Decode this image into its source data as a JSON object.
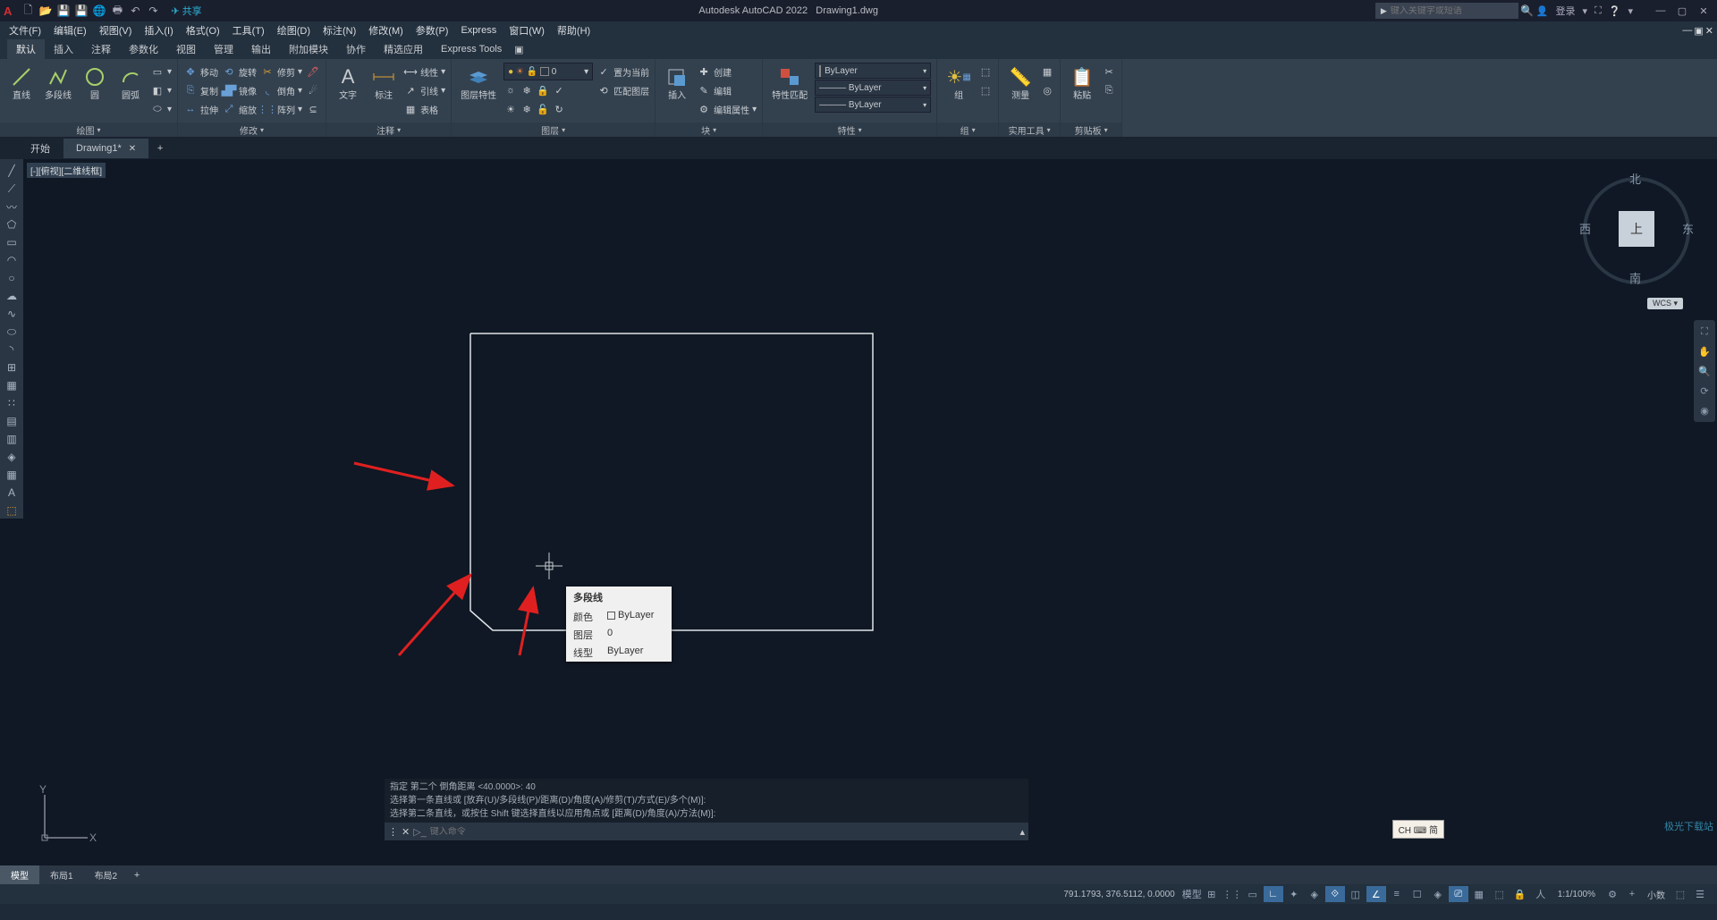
{
  "titlebar": {
    "app_name": "Autodesk AutoCAD 2022",
    "doc_name": "Drawing1.dwg",
    "share": "共享",
    "search_placeholder": "键入关键字或短语",
    "login": "登录"
  },
  "menu": {
    "items": [
      "文件(F)",
      "编辑(E)",
      "视图(V)",
      "插入(I)",
      "格式(O)",
      "工具(T)",
      "绘图(D)",
      "标注(N)",
      "修改(M)",
      "参数(P)",
      "Express",
      "窗口(W)",
      "帮助(H)"
    ]
  },
  "ribbon_tabs": [
    "默认",
    "插入",
    "注释",
    "参数化",
    "视图",
    "管理",
    "输出",
    "附加模块",
    "协作",
    "精选应用",
    "Express Tools"
  ],
  "ribbon": {
    "draw": {
      "title": "绘图",
      "line": "直线",
      "polyline": "多段线",
      "circle": "圆",
      "arc": "圆弧"
    },
    "modify": {
      "title": "修改",
      "move": "移动",
      "rotate": "旋转",
      "trim": "修剪",
      "copy": "复制",
      "mirror": "镜像",
      "fillet": "倒角",
      "stretch": "拉伸",
      "scale": "缩放",
      "array": "阵列"
    },
    "annot": {
      "title": "注释",
      "text": "文字",
      "dim": "标注",
      "linear": "线性",
      "leader": "引线",
      "table": "表格"
    },
    "layers": {
      "title": "图层",
      "props": "图层特性",
      "current_layer": "0",
      "make_current": "置为当前",
      "match": "匹配图层"
    },
    "block": {
      "title": "块",
      "insert": "插入",
      "create": "创建",
      "edit": "编辑",
      "attr": "编辑属性"
    },
    "props": {
      "title": "特性",
      "match": "特性匹配",
      "color": "ByLayer",
      "ltype": "ByLayer",
      "lweight": "ByLayer"
    },
    "groups": {
      "title": "组",
      "group": "组"
    },
    "utils": {
      "title": "实用工具",
      "measure": "测量"
    },
    "clipboard": {
      "title": "剪贴板",
      "paste": "粘贴"
    }
  },
  "filetabs": {
    "start": "开始",
    "current": "Drawing1*"
  },
  "viewport_label": "[-][俯视][二维线框]",
  "viewcube": {
    "n": "北",
    "s": "南",
    "e": "东",
    "w": "西",
    "top": "上",
    "wcs": "WCS"
  },
  "tooltip": {
    "title": "多段线",
    "color_k": "颜色",
    "color_v": "ByLayer",
    "layer_k": "图层",
    "layer_v": "0",
    "ltype_k": "线型",
    "ltype_v": "ByLayer"
  },
  "ime": "CH ⌨ 简",
  "command": {
    "h1": "指定 第二个 倒角距离 <40.0000>: 40",
    "h2": "选择第一条直线或 [放弃(U)/多段线(P)/距离(D)/角度(A)/修剪(T)/方式(E)/多个(M)]:",
    "h3": "选择第二条直线，或按住 Shift 键选择直线以应用角点或 [距离(D)/角度(A)/方法(M)]:",
    "placeholder": "键入命令"
  },
  "layouts": {
    "model": "模型",
    "l1": "布局1",
    "l2": "布局2"
  },
  "status": {
    "coords": "791.1793, 376.5112, 0.0000",
    "model": "模型",
    "zoom": "1:1/100%",
    "decimal": "小数",
    "watermark": "极光下载站"
  },
  "ucs": {
    "x": "X",
    "y": "Y"
  }
}
